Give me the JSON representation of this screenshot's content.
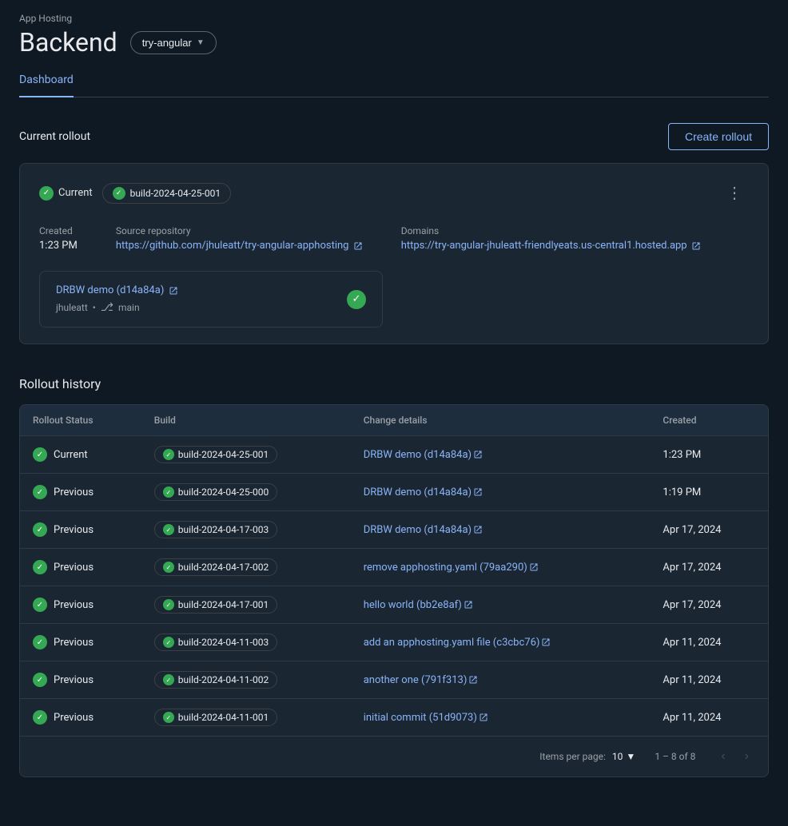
{
  "app": {
    "hosting_label": "App Hosting",
    "page_title": "Backend",
    "backend_name": "try-angular"
  },
  "tabs": [
    {
      "label": "Dashboard",
      "active": true
    }
  ],
  "current_rollout": {
    "section_title": "Current rollout",
    "create_button": "Create rollout",
    "status_label": "Current",
    "build_badge": "build-2024-04-25-001",
    "created_label": "Created",
    "created_value": "1:23 PM",
    "source_repo_label": "Source repository",
    "source_repo_url": "https://github.com/jhuleatt/try-angular-apphosting",
    "source_repo_display": "https://github.com/jhuleatt/try-angular-apphosting",
    "domains_label": "Domains",
    "domain_url": "https://try-angular-jhuleatt-friendlyeats.us-central1.hosted.app",
    "domain_display": "https://try-angular-jhuleatt-friendlyeats.us-central1.hosted.app",
    "commit_title": "DRBW demo (d14a84a)",
    "commit_user": "jhuleatt",
    "commit_branch": "main"
  },
  "rollout_history": {
    "section_title": "Rollout history",
    "table": {
      "columns": [
        "Rollout Status",
        "Build",
        "Change details",
        "Created"
      ],
      "rows": [
        {
          "status": "Current",
          "build": "build-2024-04-25-001",
          "change": "DRBW demo (d14a84a)",
          "created": "1:23 PM"
        },
        {
          "status": "Previous",
          "build": "build-2024-04-25-000",
          "change": "DRBW demo (d14a84a)",
          "created": "1:19 PM"
        },
        {
          "status": "Previous",
          "build": "build-2024-04-17-003",
          "change": "DRBW demo (d14a84a)",
          "created": "Apr 17, 2024"
        },
        {
          "status": "Previous",
          "build": "build-2024-04-17-002",
          "change": "remove apphosting.yaml (79aa290)",
          "created": "Apr 17, 2024"
        },
        {
          "status": "Previous",
          "build": "build-2024-04-17-001",
          "change": "hello world (bb2e8af)",
          "created": "Apr 17, 2024"
        },
        {
          "status": "Previous",
          "build": "build-2024-04-11-003",
          "change": "add an apphosting.yaml file (c3cbc76)",
          "created": "Apr 11, 2024"
        },
        {
          "status": "Previous",
          "build": "build-2024-04-11-002",
          "change": "another one (791f313)",
          "created": "Apr 11, 2024"
        },
        {
          "status": "Previous",
          "build": "build-2024-04-11-001",
          "change": "initial commit (51d9073)",
          "created": "Apr 11, 2024"
        }
      ],
      "footer": {
        "items_per_page_label": "Items per page:",
        "items_per_page_value": "10",
        "range_text": "1 – 8 of 8"
      }
    }
  }
}
